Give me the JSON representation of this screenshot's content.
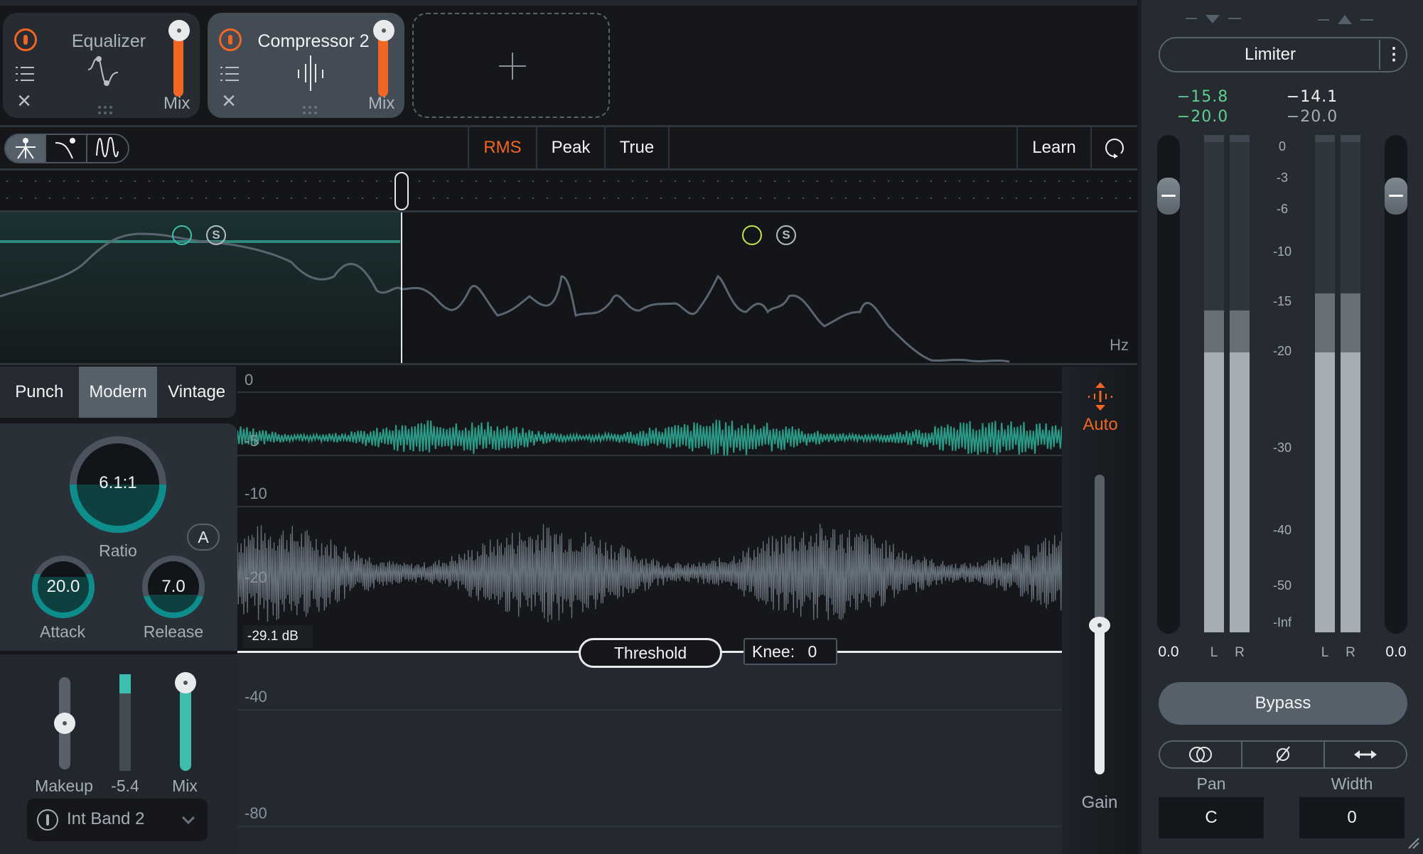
{
  "modules": [
    {
      "name": "Equalizer",
      "mix_label": "Mix",
      "enabled": true,
      "mix": 1.0,
      "icon": "eq-curve-icon"
    },
    {
      "name": "Compressor 2",
      "mix_label": "Mix",
      "enabled": true,
      "mix": 1.0,
      "icon": "compressor-icon",
      "selected": true
    }
  ],
  "add_module": {
    "icon": "plus-icon"
  },
  "toolbar": {
    "detection_modes": [
      "crossover-dancer-icon",
      "curve-icon",
      "waveform-icon"
    ],
    "active_mode": 0,
    "rms": "RMS",
    "peak": "Peak",
    "true": "True",
    "active_level": "RMS",
    "learn": "Learn",
    "loop_icon": "loop-icon"
  },
  "spectrum": {
    "hz_label": "Hz",
    "bands": [
      {
        "enabled": true,
        "solo_label": "S",
        "color": "#3ebfad"
      },
      {
        "enabled": true,
        "solo_label": "S",
        "color": "#c6e34a"
      }
    ]
  },
  "styles": {
    "tabs": [
      "Punch",
      "Modern",
      "Vintage"
    ],
    "active": "Modern"
  },
  "knobs": {
    "ratio": {
      "label": "Ratio",
      "value": "6.1:1",
      "fill": 0.5
    },
    "attack": {
      "label": "Attack",
      "value": "20.0",
      "fill": 0.7
    },
    "release": {
      "label": "Release",
      "value": "7.0",
      "fill": 0.35
    },
    "auto_label": "A"
  },
  "sliders": {
    "makeup": {
      "label": "Makeup",
      "position": 0.5
    },
    "gain_reduction": {
      "label": "-5.4",
      "fill": 0.2
    },
    "mix": {
      "label": "Mix",
      "position": 1.0
    }
  },
  "band_select": {
    "value": "Int Band 2"
  },
  "waveform": {
    "db_labels": [
      "0",
      "-5",
      "-10",
      "-20",
      "-40",
      "-80"
    ],
    "threshold_readout": "-29.1 dB",
    "threshold_label": "Threshold",
    "knee_label": "Knee:",
    "knee_value": "0"
  },
  "gain": {
    "auto_label": "Auto",
    "label": "Gain",
    "position": 0.5
  },
  "output": {
    "limiter_label": "Limiter",
    "in_readouts": {
      "peak": "−15.8",
      "rms": "−20.0"
    },
    "out_readouts": {
      "peak": "−14.1",
      "rms": "−20.0"
    },
    "scale": [
      "0",
      "-3",
      "-6",
      "-10",
      "-15",
      "-20",
      "-30",
      "-40",
      "-50",
      "-Inf"
    ],
    "in_gain": "0.0",
    "out_gain": "0.0",
    "channels": [
      "L",
      "R",
      "L",
      "R"
    ],
    "in_levels_db": {
      "rms": -20.0,
      "peak": -15.8
    },
    "out_levels_db": {
      "rms": -20.0,
      "peak": -14.1
    },
    "bypass_label": "Bypass",
    "stereo_buttons": [
      "stereo-link-icon",
      "phase-invert-icon",
      "width-arrows-icon"
    ],
    "pan_label": "Pan",
    "pan_value": "C",
    "width_label": "Width",
    "width_value": "0"
  }
}
